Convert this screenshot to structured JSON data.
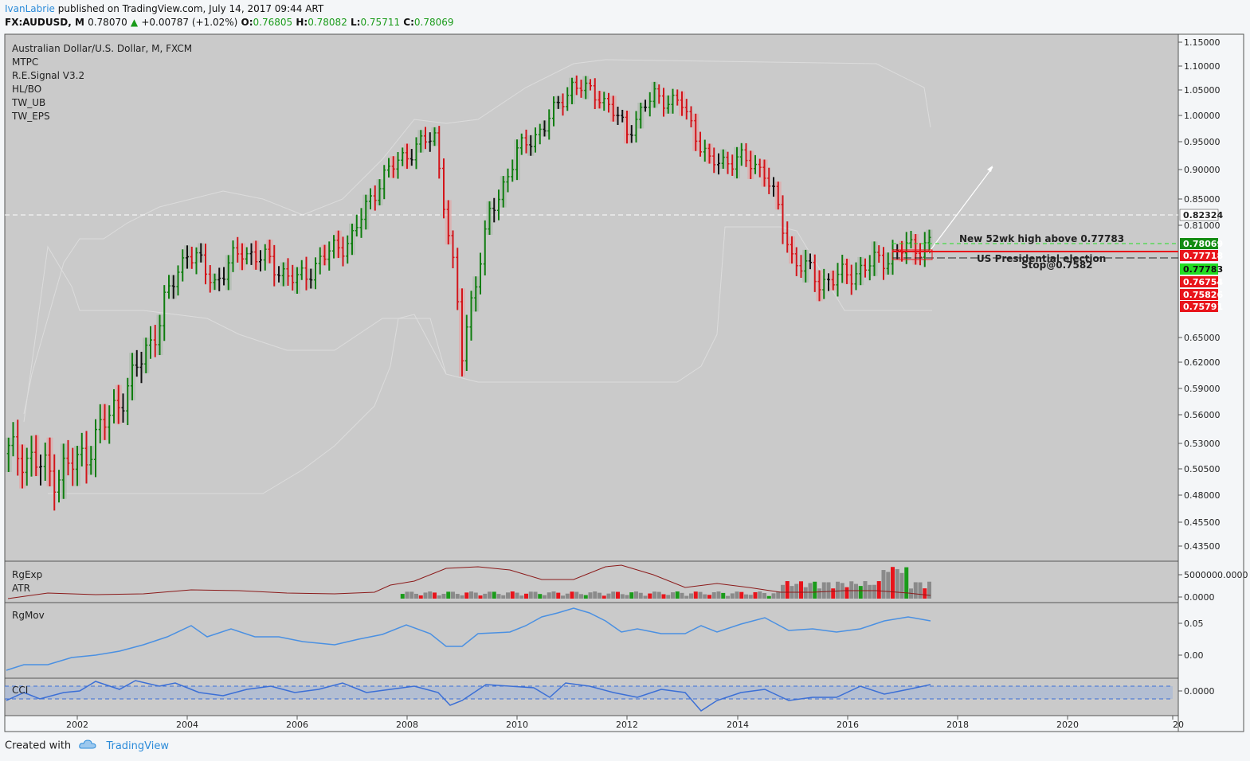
{
  "header": {
    "author": "IvanLabrie",
    "published_text": "published on TradingView.com, July 14, 2017 09:44 ART",
    "symbol": "FX:AUDUSD, M",
    "last": "0.78070",
    "change": "+0.00787 (+1.02%)",
    "o_label": "O:",
    "o_value": "0.76805",
    "h_label": "H:",
    "h_value": "0.78082",
    "l_label": "L:",
    "l_value": "0.75711",
    "c_label": "C:",
    "c_value": "0.78069"
  },
  "legend": {
    "title": "Australian Dollar/U.S. Dollar, M, FXCM",
    "indicators": [
      "MTPC",
      "R.E.Signal V3.2",
      "HL/BO",
      "TW_UB",
      "TW_EPS"
    ]
  },
  "panes": {
    "volume_labels": [
      "RgExp",
      "ATR"
    ],
    "momentum_label": "RgMov",
    "cci_label": "CCI"
  },
  "annotations": {
    "new_high": "New 52wk high above 0.77783",
    "election": "US Presidential election",
    "stop": "Stop@0.7582"
  },
  "price_badges": [
    {
      "value": "0.82324",
      "color": "#ffffff",
      "text_color": "#222222"
    },
    {
      "value": "0.78069",
      "color": "#128c12",
      "text_color": "#ffffff"
    },
    {
      "value": "0.77718",
      "color": "#e8141b",
      "text_color": "#ffffff"
    },
    {
      "value": "0.77783",
      "color": "#22dd22",
      "text_color": "#111111"
    },
    {
      "value": "0.76754",
      "color": "#e8141b",
      "text_color": "#ffffff"
    },
    {
      "value": "0.75826",
      "color": "#e8141b",
      "text_color": "#ffffff"
    },
    {
      "value": "0.75791",
      "color": "#e8141b",
      "text_color": "#ffffff"
    }
  ],
  "colors": {
    "up": "#0f7d0f",
    "down": "#d3141a",
    "neutral": "#111111",
    "plot_bg": "#cacaca",
    "line_blue": "#4a90e2",
    "atr_line": "#8b1a1a"
  },
  "footer": {
    "created_with": "Created with",
    "brand": "TradingView"
  },
  "chart_data": [
    {
      "type": "candlestick",
      "title": "Australian Dollar/U.S. Dollar, M, FXCM",
      "y_axis_ticks": [
        "1.15000",
        "1.10000",
        "1.05000",
        "1.00000",
        "0.95000",
        "0.90000",
        "0.85000",
        "0.81000",
        "0.65000",
        "0.62000",
        "0.59000",
        "0.56000",
        "0.53000",
        "0.50500",
        "0.48000",
        "0.45500",
        "0.43500"
      ],
      "x_axis_ticks": [
        "2002",
        "2004",
        "2006",
        "2008",
        "2010",
        "2012",
        "2014",
        "2016",
        "2018",
        "2020",
        "20"
      ],
      "x": [
        2001.0,
        2001.5,
        2002.0,
        2002.5,
        2003.0,
        2003.5,
        2004.0,
        2004.5,
        2005.0,
        2005.5,
        2006.0,
        2006.5,
        2007.0,
        2007.5,
        2008.0,
        2008.5,
        2009.0,
        2009.5,
        2010.0,
        2010.5,
        2011.0,
        2011.5,
        2012.0,
        2012.5,
        2013.0,
        2013.5,
        2014.0,
        2014.5,
        2015.0,
        2015.5,
        2016.0,
        2016.5,
        2017.0,
        2017.5
      ],
      "close": [
        0.52,
        0.5,
        0.51,
        0.55,
        0.6,
        0.67,
        0.77,
        0.72,
        0.77,
        0.75,
        0.72,
        0.76,
        0.79,
        0.88,
        0.93,
        0.96,
        0.63,
        0.82,
        0.93,
        0.98,
        1.06,
        1.04,
        0.97,
        1.04,
        1.02,
        0.91,
        0.92,
        0.9,
        0.76,
        0.72,
        0.73,
        0.75,
        0.77,
        0.78
      ],
      "last_value": 0.78069,
      "horizontal_line": 0.82324
    },
    {
      "type": "bar",
      "title": "RgExp / ATR",
      "y_axis_ticks": [
        "5000000.0000",
        "0.0000"
      ]
    },
    {
      "type": "line",
      "title": "RgMov",
      "y_axis_ticks": [
        "0.05",
        "0.00"
      ],
      "x": [
        2000.8,
        2001.5,
        2002.5,
        2003.5,
        2004.0,
        2004.5,
        2005.5,
        2006.5,
        2007.5,
        2008.5,
        2009.0,
        2009.5,
        2010.5,
        2011.0,
        2011.5,
        2012.0,
        2012.5,
        2013.0,
        2013.5,
        2014.0,
        2014.5,
        2015.0,
        2015.5,
        2016.0,
        2016.5,
        2017.0,
        2017.5
      ],
      "y": [
        -0.02,
        -0.01,
        0.0,
        0.03,
        0.055,
        0.04,
        0.05,
        0.03,
        0.05,
        0.06,
        0.015,
        0.04,
        0.06,
        0.09,
        0.07,
        0.05,
        0.045,
        0.05,
        0.035,
        0.04,
        0.06,
        0.05,
        0.04,
        0.045,
        0.05,
        0.065,
        0.06
      ]
    },
    {
      "type": "line",
      "title": "CCI",
      "y_axis_ticks": [
        "0.0000"
      ]
    }
  ]
}
